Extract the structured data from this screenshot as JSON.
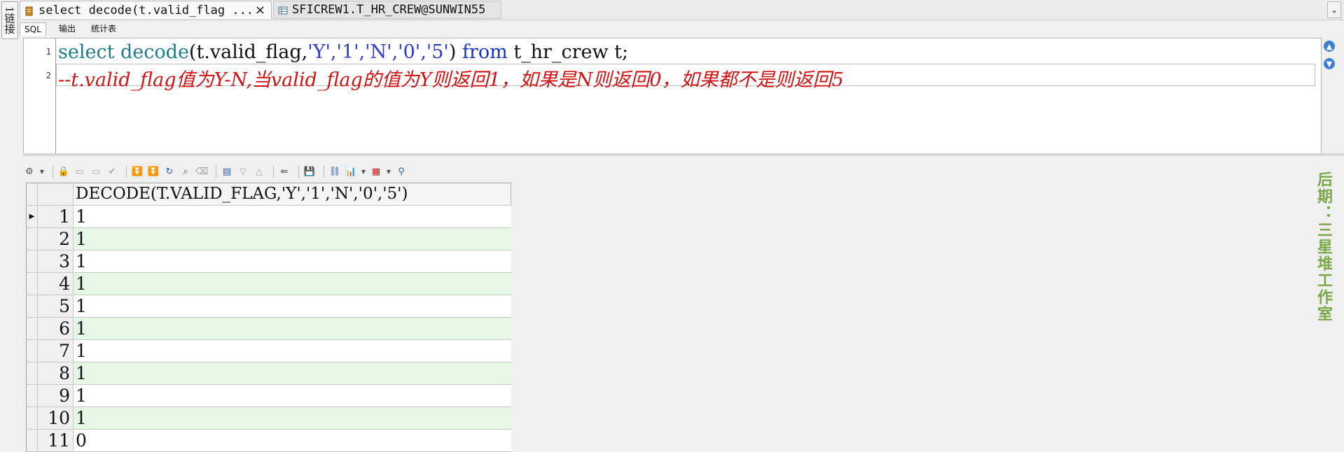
{
  "left_strip": {
    "label": "1链接"
  },
  "tabs": [
    {
      "label": "select decode(t.valid_flag ...",
      "close": "×",
      "icon": "sql-file-icon",
      "active": true
    },
    {
      "label": "SFICREW1.T_HR_CREW@SUNWIN55",
      "icon": "table-icon",
      "active": false
    }
  ],
  "tab_dropdown": "⌄",
  "subtabs": [
    "SQL",
    "输出",
    "统计表"
  ],
  "editor": {
    "line_numbers": [
      "1",
      "2"
    ],
    "line1": {
      "select": "select",
      "decode": "decode",
      "open": "(t.valid_flag,",
      "args": "'Y','1','N','0','5'",
      "close": ")",
      "from": "from",
      "rest": "t_hr_crew t;"
    },
    "line2": "--t.valid_flag值为Y-N,当valid_flag的值为Y则返回1，如果是N则返回0，如果都不是则返回5"
  },
  "grid": {
    "column_header": "DECODE(T.VALID_FLAG,'Y','1','N','0','5')",
    "current_row_marker": "▶",
    "rows": [
      {
        "n": "1",
        "v": "1"
      },
      {
        "n": "2",
        "v": "1"
      },
      {
        "n": "3",
        "v": "1"
      },
      {
        "n": "4",
        "v": "1"
      },
      {
        "n": "5",
        "v": "1"
      },
      {
        "n": "6",
        "v": "1"
      },
      {
        "n": "7",
        "v": "1"
      },
      {
        "n": "8",
        "v": "1"
      },
      {
        "n": "9",
        "v": "1"
      },
      {
        "n": "10",
        "v": "1"
      },
      {
        "n": "11",
        "v": "0"
      }
    ]
  },
  "watermark": "后期：三星堆工作室",
  "colors": {
    "keyword": "#1d7d8e",
    "string": "#2a39d0",
    "comment": "#d11313",
    "alt_row": "#e6f7e6"
  }
}
